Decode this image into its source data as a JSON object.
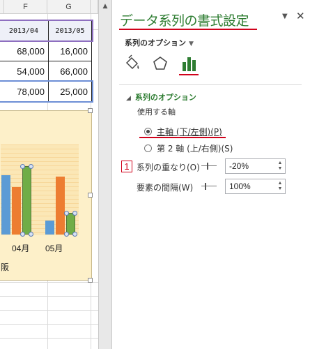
{
  "spreadsheet": {
    "columns": [
      "F",
      "G"
    ],
    "header_row": [
      "2013/04",
      "2013/05"
    ],
    "rows": [
      [
        "68,000",
        "16,000"
      ],
      [
        "54,000",
        "66,000"
      ],
      [
        "78,000",
        "25,000"
      ]
    ]
  },
  "chart": {
    "category_labels": [
      "04月",
      "05月"
    ],
    "legend_fragment": "阪"
  },
  "chart_data": {
    "type": "bar",
    "categories": [
      "04月",
      "05月"
    ],
    "series": [
      {
        "values": [
          68000,
          16000
        ],
        "color": "#5b9bd5"
      },
      {
        "values": [
          54000,
          66000
        ],
        "color": "#ed7d31"
      },
      {
        "values": [
          78000,
          25000
        ],
        "color": "#70ad47",
        "selected": true
      }
    ],
    "ylim": [
      0,
      80000
    ],
    "grid": false
  },
  "pane": {
    "title": "データ系列の書式設定",
    "options_dropdown": "系列のオプション",
    "tabs": [
      "fill-line",
      "effects",
      "series-options"
    ],
    "active_tab": "series-options",
    "section_title": "系列のオプション",
    "axis_label": "使用する軸",
    "radio_primary": "主軸 (下/左側)(P)",
    "radio_secondary": "第 2 軸 (上/右側)(S)",
    "selected_axis": "primary",
    "badge": "1",
    "overlap_label": "系列の重なり(O)",
    "overlap_value": "-20%",
    "gap_label": "要素の間隔(W)",
    "gap_value": "100%"
  },
  "colors": {
    "accent_green": "#2e7d32",
    "annotation_red": "#d0021b",
    "chart_background": "#fdf0c9"
  }
}
